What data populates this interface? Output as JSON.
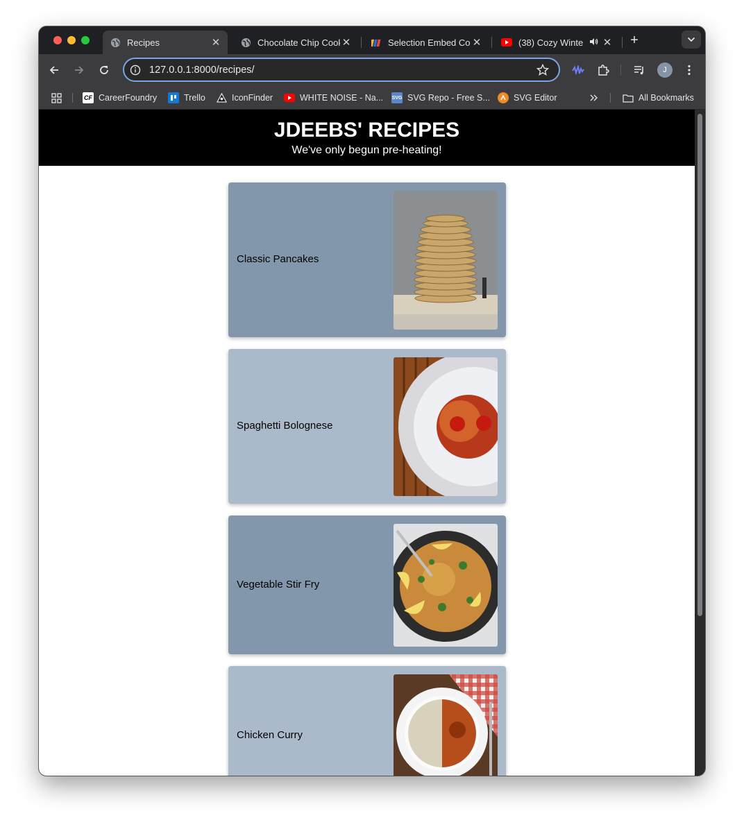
{
  "browser": {
    "tabs": [
      {
        "title": "Recipes",
        "active": true
      },
      {
        "title": "Chocolate Chip Cook",
        "active": false
      },
      {
        "title": "Selection Embed Co",
        "active": false
      },
      {
        "title": "(38) Cozy Winte",
        "active": false
      }
    ],
    "url": "127.0.0.1:8000/recipes/",
    "avatar_initial": "J",
    "bookmarks": [
      {
        "label": "CareerFoundry",
        "icon": "careerfoundry-icon"
      },
      {
        "label": "Trello",
        "icon": "trello-icon"
      },
      {
        "label": "IconFinder",
        "icon": "iconfinder-icon"
      },
      {
        "label": "WHITE NOISE - Na...",
        "icon": "youtube-icon"
      },
      {
        "label": "SVG Repo - Free S...",
        "icon": "svgrepo-icon"
      },
      {
        "label": "SVG Editor",
        "icon": "svg-editor-icon"
      }
    ],
    "all_bookmarks_label": "All Bookmarks"
  },
  "site": {
    "title": "JDEEBS' RECIPES",
    "subtitle": "We've only begun pre-heating!"
  },
  "recipes": [
    {
      "name": "Classic Pancakes",
      "card_color": "#8297ab",
      "image": "pancake-stack-photo"
    },
    {
      "name": "Spaghetti Bolognese",
      "card_color": "#aabacb",
      "image": "spaghetti-plate-photo"
    },
    {
      "name": "Vegetable Stir Fry",
      "card_color": "#8297ab",
      "image": "paella-pan-photo"
    },
    {
      "name": "Chicken Curry",
      "card_color": "#aabacb",
      "image": "curry-rice-plate-photo"
    }
  ],
  "colors": {
    "header_bg": "#000000",
    "omnibox_focus": "#7ba5e8",
    "tab_active": "#3c3c3f"
  }
}
